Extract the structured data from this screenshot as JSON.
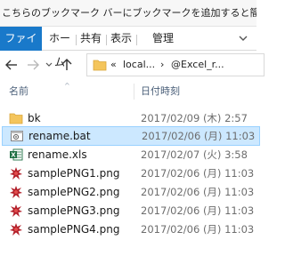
{
  "bookmark_bar": {
    "text": "こちらのブックマーク バーにブックマークを追加すると簡単に..."
  },
  "ribbon": {
    "tabs": [
      "ファイル",
      "ホーム",
      "共有",
      "表示",
      "管理"
    ]
  },
  "address": {
    "crumbs": [
      "«",
      "local...",
      "›",
      "@Excel_r..."
    ]
  },
  "columns": {
    "name": "名前",
    "date": "日付時刻"
  },
  "files": [
    {
      "name": "bk",
      "date": "2017/02/09 (木) 2:57",
      "icon": "folder-icon"
    },
    {
      "name": "rename.bat",
      "date": "2017/02/06 (月) 11:03",
      "icon": "batch-file-icon"
    },
    {
      "name": "rename.xls",
      "date": "2017/02/07 (火) 3:58",
      "icon": "excel-file-icon"
    },
    {
      "name": "samplePNG1.png",
      "date": "2017/02/06 (月) 11:03",
      "icon": "image-file-icon"
    },
    {
      "name": "samplePNG2.png",
      "date": "2017/02/06 (月) 11:03",
      "icon": "image-file-icon"
    },
    {
      "name": "samplePNG3.png",
      "date": "2017/02/06 (月) 11:03",
      "icon": "image-file-icon"
    },
    {
      "name": "samplePNG4.png",
      "date": "2017/02/06 (月) 11:03",
      "icon": "image-file-icon"
    }
  ],
  "selected_file": "rename.bat",
  "colors": {
    "file_tab": "#1979ca",
    "selection": "#cce8ff",
    "folder": "#f4c55c"
  }
}
